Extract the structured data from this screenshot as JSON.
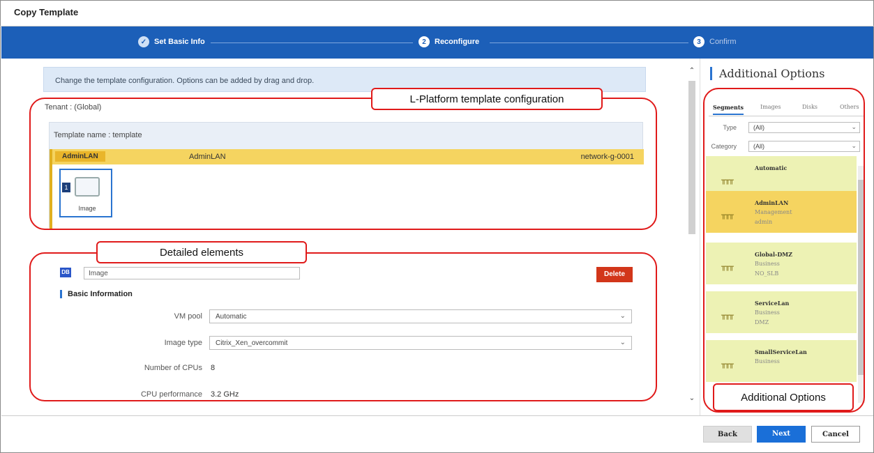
{
  "window": {
    "title": "Copy Template"
  },
  "steps": [
    {
      "label": "Set Basic Info",
      "marker": "✓"
    },
    {
      "label": "Reconfigure",
      "marker": "2"
    },
    {
      "label": "Confirm",
      "marker": "3"
    }
  ],
  "info_message": "Change the template configuration. Options can be added by drag and drop.",
  "tenant": "Tenant : (Global)",
  "template": {
    "name_label": "Template name : template",
    "segment": {
      "tag": "AdminLAN",
      "name": "AdminLAN",
      "network": "network-g-0001"
    },
    "image_card": {
      "number": "1",
      "label": "Image"
    }
  },
  "callouts": {
    "platform": "L-Platform template configuration",
    "detailed": "Detailed elements",
    "options": "Additional Options"
  },
  "detail": {
    "badge": "DB",
    "name_value": "Image",
    "delete_label": "Delete",
    "section_title": "Basic Information",
    "fields": {
      "vm_pool": {
        "label": "VM pool",
        "value": "Automatic"
      },
      "image_type": {
        "label": "Image type",
        "value": "Citrix_Xen_overcommit"
      },
      "cpus": {
        "label": "Number of CPUs",
        "value": "8"
      },
      "cpu_perf": {
        "label": "CPU performance",
        "value": "3.2 GHz"
      }
    }
  },
  "options_panel": {
    "title": "Additional Options",
    "tabs": [
      "Segments",
      "Images",
      "Disks",
      "Others"
    ],
    "filters": {
      "type": {
        "label": "Type",
        "value": "(All)"
      },
      "category": {
        "label": "Category",
        "value": "(All)"
      }
    },
    "items": [
      {
        "name": "Automatic",
        "line2": "",
        "line3": ""
      },
      {
        "name": "AdminLAN",
        "line2": "Management",
        "line3": "admin"
      },
      {
        "name": "Global-DMZ",
        "line2": "Business",
        "line3": "NO_SLB"
      },
      {
        "name": "ServiceLan",
        "line2": "Business",
        "line3": "DMZ"
      },
      {
        "name": "SmallServiceLan",
        "line2": "Business",
        "line3": ""
      }
    ]
  },
  "footer": {
    "back": "Back",
    "next": "Next",
    "cancel": "Cancel"
  },
  "colors": {
    "step_bar": "#1c5fb8",
    "callout": "#e01a1a",
    "delete": "#d2361a",
    "segment": "#f5d460",
    "next": "#1a6fd8"
  }
}
